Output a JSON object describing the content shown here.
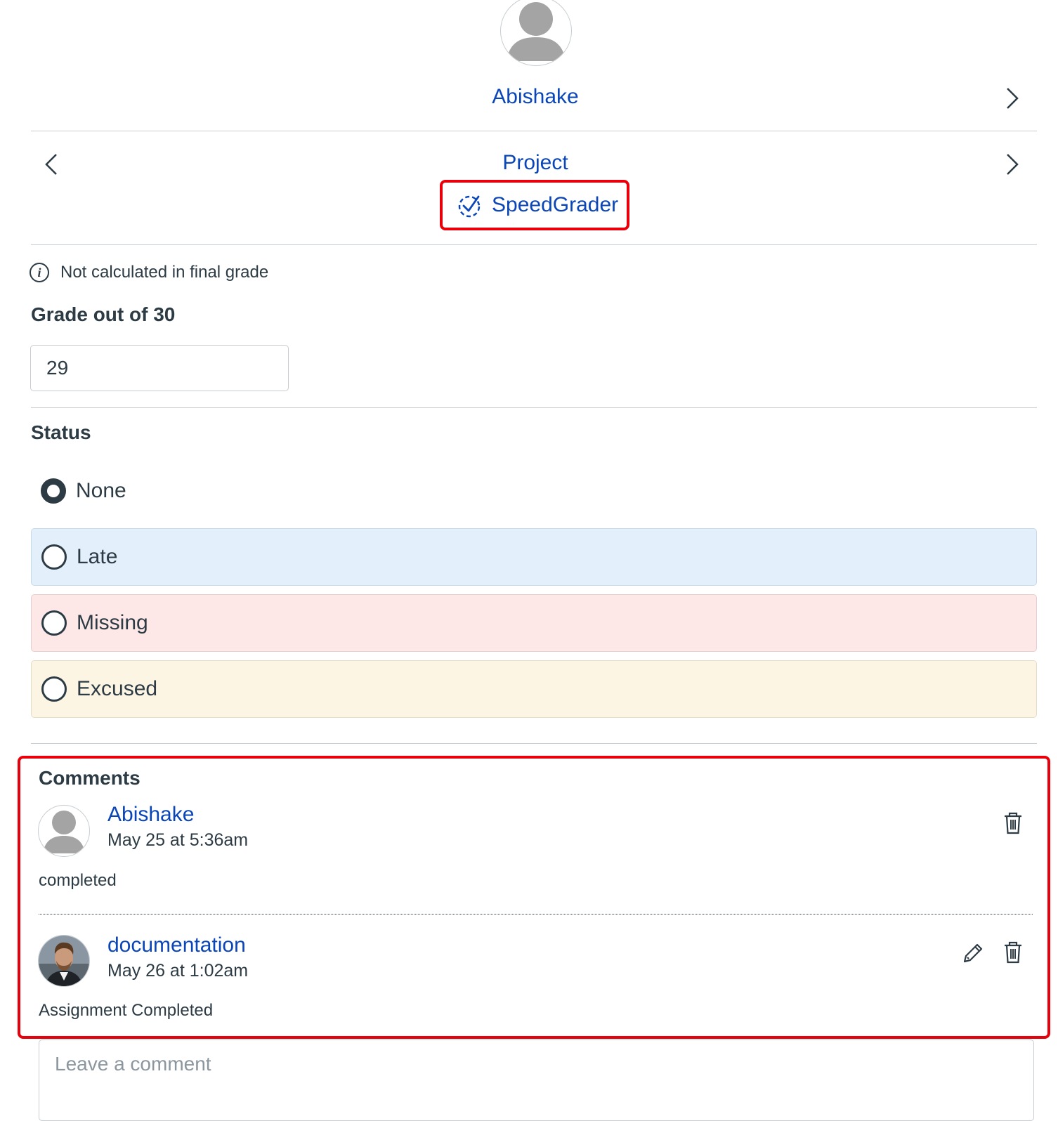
{
  "student": {
    "name": "Abishake"
  },
  "assignment": {
    "name": "Project",
    "speedgrader_label": "SpeedGrader",
    "info_text": "Not calculated in final grade",
    "grade_label": "Grade out of 30",
    "grade_value": "29"
  },
  "status": {
    "label": "Status",
    "options": [
      {
        "label": "None",
        "selected": true
      },
      {
        "label": "Late",
        "selected": false,
        "color": "#e3f0fb"
      },
      {
        "label": "Missing",
        "selected": false,
        "color": "#fde7e7"
      },
      {
        "label": "Excused",
        "selected": false,
        "color": "#fdf5e4"
      }
    ]
  },
  "comments": {
    "title": "Comments",
    "items": [
      {
        "author": "Abishake",
        "date": "May 25 at 5:36am",
        "text": "completed",
        "avatar": "default-avatar-icon",
        "actions": [
          "trash-icon"
        ]
      },
      {
        "author": "documentation",
        "date": "May 26 at 1:02am",
        "text": "Assignment Completed",
        "avatar": "photo-avatar",
        "actions": [
          "pencil-icon",
          "trash-icon"
        ]
      }
    ],
    "input_placeholder": "Leave a comment"
  },
  "colors": {
    "link": "#0b46b8",
    "text": "#2d3b45",
    "highlight": "#e8000b"
  }
}
